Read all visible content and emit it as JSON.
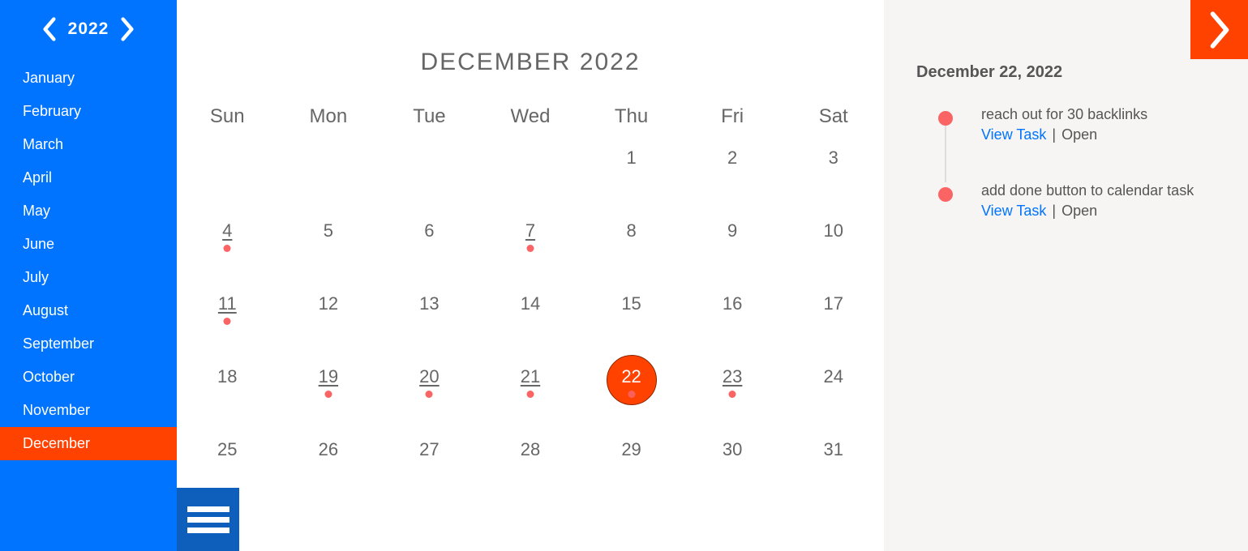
{
  "sidebar": {
    "year": "2022",
    "months": [
      "January",
      "February",
      "March",
      "April",
      "May",
      "June",
      "July",
      "August",
      "September",
      "October",
      "November",
      "December"
    ],
    "selected_index": 11
  },
  "calendar": {
    "title": "DECEMBER 2022",
    "weekdays": [
      "Sun",
      "Mon",
      "Tue",
      "Wed",
      "Thu",
      "Fri",
      "Sat"
    ],
    "cells": [
      {
        "n": null
      },
      {
        "n": null
      },
      {
        "n": null
      },
      {
        "n": null
      },
      {
        "n": "1"
      },
      {
        "n": "2"
      },
      {
        "n": "3"
      },
      {
        "n": "4",
        "has_task": true,
        "underlined": true
      },
      {
        "n": "5"
      },
      {
        "n": "6"
      },
      {
        "n": "7",
        "has_task": true,
        "underlined": true
      },
      {
        "n": "8"
      },
      {
        "n": "9"
      },
      {
        "n": "10"
      },
      {
        "n": "11",
        "has_task": true,
        "underlined": true
      },
      {
        "n": "12"
      },
      {
        "n": "13"
      },
      {
        "n": "14"
      },
      {
        "n": "15"
      },
      {
        "n": "16"
      },
      {
        "n": "17"
      },
      {
        "n": "18"
      },
      {
        "n": "19",
        "has_task": true,
        "underlined": true
      },
      {
        "n": "20",
        "has_task": true,
        "underlined": true
      },
      {
        "n": "21",
        "has_task": true,
        "underlined": true
      },
      {
        "n": "22",
        "has_task": true,
        "selected": true
      },
      {
        "n": "23",
        "has_task": true,
        "underlined": true
      },
      {
        "n": "24"
      },
      {
        "n": "25"
      },
      {
        "n": "26"
      },
      {
        "n": "27"
      },
      {
        "n": "28"
      },
      {
        "n": "29"
      },
      {
        "n": "30"
      },
      {
        "n": "31"
      }
    ]
  },
  "detail": {
    "date_label": "December 22, 2022",
    "view_task_label": "View Task",
    "tasks": [
      {
        "title": "reach out for 30 backlinks",
        "status": "Open"
      },
      {
        "title": "add done button to calendar task",
        "status": "Open"
      }
    ]
  }
}
